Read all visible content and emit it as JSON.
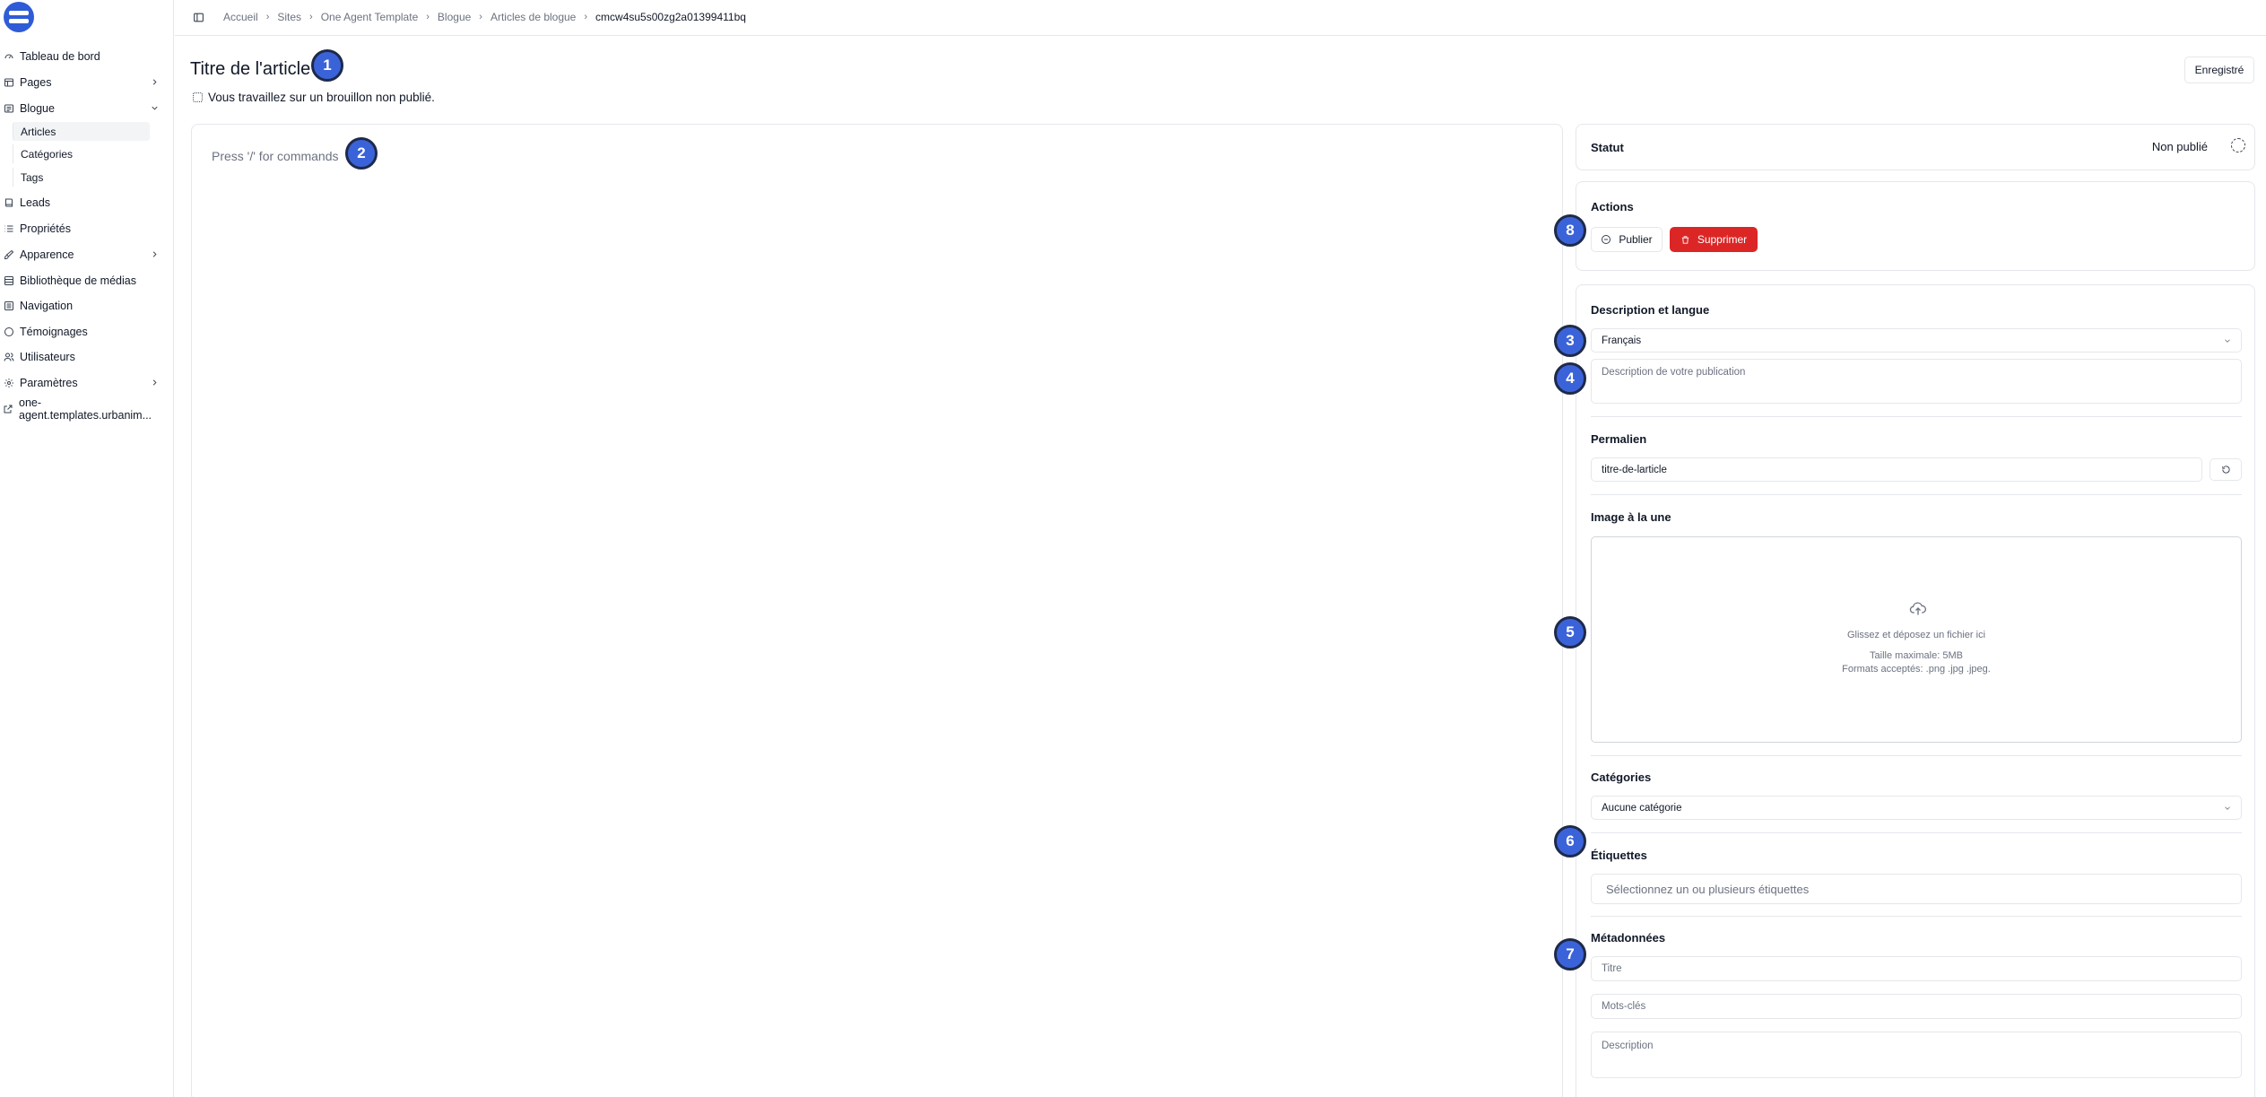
{
  "sidebar": {
    "items": [
      {
        "label": "Tableau de bord",
        "icon": "gauge-icon"
      },
      {
        "label": "Pages",
        "icon": "pages-icon"
      },
      {
        "label": "Blogue",
        "icon": "blog-icon"
      },
      {
        "label": "Leads",
        "icon": "book-icon"
      },
      {
        "label": "Propriétés",
        "icon": "list-icon"
      },
      {
        "label": "Apparence",
        "icon": "brush-icon"
      },
      {
        "label": "Bibliothèque de médias",
        "icon": "media-icon"
      },
      {
        "label": "Navigation",
        "icon": "navigation-icon"
      },
      {
        "label": "Témoignages",
        "icon": "testimonial-icon"
      },
      {
        "label": "Utilisateurs",
        "icon": "users-icon"
      },
      {
        "label": "Paramètres",
        "icon": "gear-icon"
      },
      {
        "label": "one-agent.templates.urbanim...",
        "icon": "external-link-icon"
      }
    ],
    "blog_sub": [
      "Articles",
      "Catégories",
      "Tags"
    ]
  },
  "breadcrumb": [
    "Accueil",
    "Sites",
    "One Agent Template",
    "Blogue",
    "Articles de blogue",
    "cmcw4su5s00zg2a01399411bq"
  ],
  "page": {
    "title": "Titre de l'article",
    "draft_note": "Vous travaillez sur un brouillon non publié.",
    "save_state": "Enregistré"
  },
  "editor": {
    "placeholder": "Press '/' for commands"
  },
  "status": {
    "title": "Statut",
    "value": "Non publié"
  },
  "actions": {
    "title": "Actions",
    "publish": "Publier",
    "delete": "Supprimer"
  },
  "description": {
    "title": "Description et langue",
    "language": "Français",
    "placeholder": "Description de votre publication"
  },
  "permalink": {
    "title": "Permalien",
    "value": "titre-de-larticle"
  },
  "featured_image": {
    "title": "Image à la une",
    "drop_text": "Glissez et déposez un fichier ici",
    "max_size": "Taille maximale: 5MB",
    "formats": "Formats acceptés: .png .jpg .jpeg."
  },
  "categories": {
    "title": "Catégories",
    "value": "Aucune catégorie"
  },
  "tags": {
    "title": "Étiquettes",
    "placeholder": "Sélectionnez un ou plusieurs étiquettes"
  },
  "metadata": {
    "title": "Métadonnées",
    "title_placeholder": "Titre",
    "keywords_placeholder": "Mots-clés",
    "description_placeholder": "Description"
  },
  "markers": [
    "1",
    "2",
    "3",
    "4",
    "5",
    "6",
    "7",
    "8"
  ],
  "colors": {
    "brand": "#2f5cd6",
    "danger": "#dc2626",
    "marker": "#3b63d9"
  }
}
